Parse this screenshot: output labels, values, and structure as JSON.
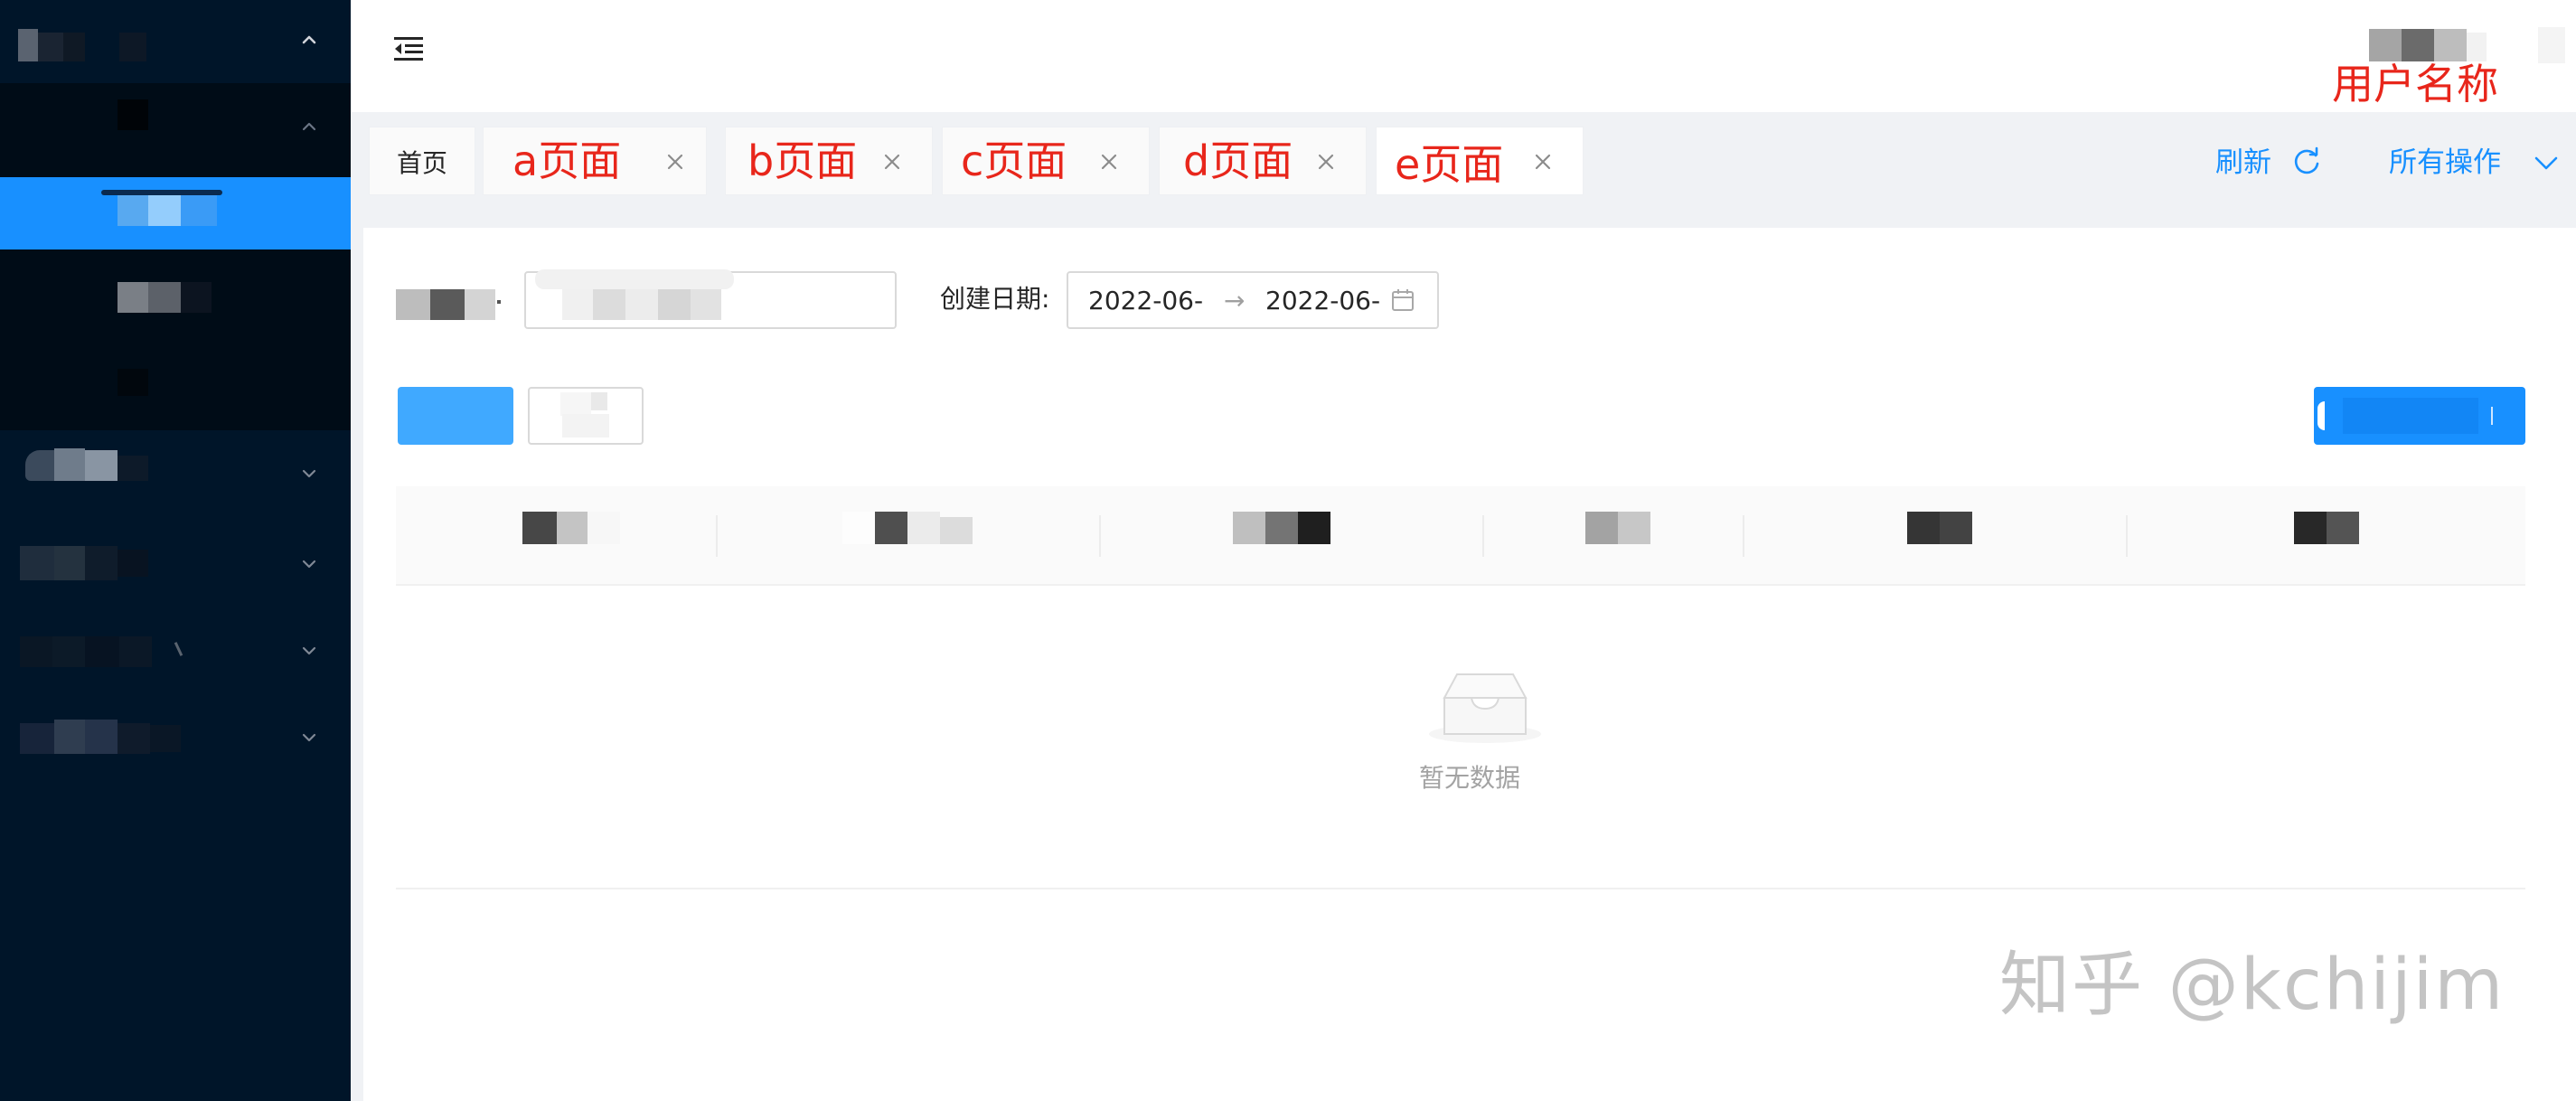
{
  "header": {
    "user_name": "用户名称",
    "collapse_icon": "menu-fold-icon"
  },
  "tabs": [
    {
      "label": "首页",
      "closable": false,
      "active": false
    },
    {
      "label": "a页面",
      "closable": true,
      "active": false
    },
    {
      "label": "b页面",
      "closable": true,
      "active": false
    },
    {
      "label": "c页面",
      "closable": true,
      "active": false
    },
    {
      "label": "d页面",
      "closable": true,
      "active": false
    },
    {
      "label": "e页面",
      "closable": true,
      "active": true
    }
  ],
  "tab_actions": {
    "refresh_label": "刷新",
    "refresh_icon": "reload-icon",
    "all_ops_label": "所有操作",
    "all_ops_icon": "chevron-down-icon"
  },
  "filter": {
    "date_label": "创建日期:",
    "date_start": "2022-06-",
    "date_end": "2022-06-",
    "date_separator": "→"
  },
  "table": {
    "empty_text": "暂无数据"
  },
  "watermark": "知乎 @kchijim",
  "colors": {
    "sidebar_bg": "#001529",
    "submenu_bg": "#000c17",
    "primary": "#1890ff",
    "annotation_red": "#e8261b"
  }
}
